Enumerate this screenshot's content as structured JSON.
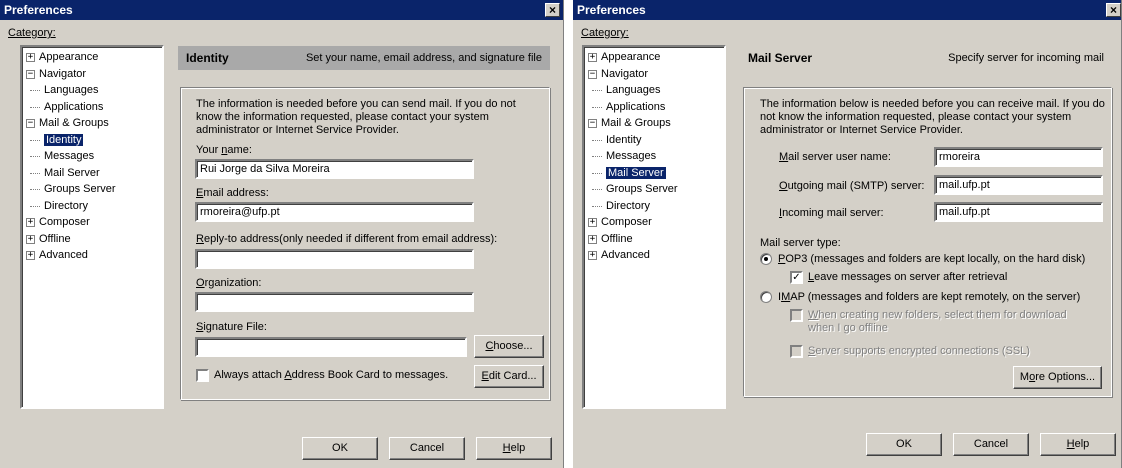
{
  "left": {
    "title": "Preferences",
    "close": "×",
    "category_label": "Category:",
    "tree": [
      {
        "label": "Appearance",
        "box": "+"
      },
      {
        "label": "Navigator",
        "box": "−"
      },
      {
        "label": "Languages"
      },
      {
        "label": "Applications"
      },
      {
        "label": "Mail & Groups",
        "box": "−"
      },
      {
        "label": "Identity",
        "selected": true
      },
      {
        "label": "Messages"
      },
      {
        "label": "Mail Server"
      },
      {
        "label": "Groups Server"
      },
      {
        "label": "Directory"
      },
      {
        "label": "Composer",
        "box": "+"
      },
      {
        "label": "Offline",
        "box": "+"
      },
      {
        "label": "Advanced",
        "box": "+"
      }
    ],
    "panel": {
      "title": "Identity",
      "description": "Set your name, email address, and signature file",
      "intro": [
        "The information is needed before you can send mail.  If you do not",
        "know the information requested, please contact your system",
        "administrator or Internet Service Provider."
      ],
      "name_label_pre": "Your ",
      "name_label_u": "n",
      "name_label_post": "ame:",
      "name_value": "Rui Jorge da Silva Moreira",
      "email_label_pre": "",
      "email_label_u": "E",
      "email_label_post": "mail address:",
      "email_value": "rmoreira@ufp.pt",
      "reply_label_pre": "",
      "reply_label_u": "R",
      "reply_label_post": "eply-to address(only needed if different from email address):",
      "reply_value": "",
      "org_label_pre": "",
      "org_label_u": "O",
      "org_label_post": "rganization:",
      "org_value": "",
      "sig_label_pre": "",
      "sig_label_u": "S",
      "sig_label_post": "ignature File:",
      "sig_value": "",
      "choose_u": "C",
      "choose_post": "hoose...",
      "attach_pre": "Always attach ",
      "attach_u": "A",
      "attach_post": "ddress Book Card to messages.",
      "attach_checked": false,
      "editcard_u": "E",
      "editcard_post": "dit Card..."
    },
    "buttons": {
      "ok": "OK",
      "cancel": "Cancel",
      "help_u": "H",
      "help_post": "elp"
    }
  },
  "right": {
    "title": "Preferences",
    "close": "×",
    "category_label": "Category:",
    "tree": [
      {
        "label": "Appearance",
        "box": "+"
      },
      {
        "label": "Navigator",
        "box": "−"
      },
      {
        "label": "Languages"
      },
      {
        "label": "Applications"
      },
      {
        "label": "Mail & Groups",
        "box": "−"
      },
      {
        "label": "Identity"
      },
      {
        "label": "Messages"
      },
      {
        "label": "Mail Server",
        "selected": true
      },
      {
        "label": "Groups Server"
      },
      {
        "label": "Directory"
      },
      {
        "label": "Composer",
        "box": "+"
      },
      {
        "label": "Offline",
        "box": "+"
      },
      {
        "label": "Advanced",
        "box": "+"
      }
    ],
    "panel": {
      "title": "Mail Server",
      "description": "Specify server for incoming mail",
      "intro": [
        "The information below is needed before you can receive mail.  If you do",
        "not know the information requested, please contact your system",
        "administrator or Internet Service Provider."
      ],
      "user_label_u": "M",
      "user_label_post": "ail server user name:",
      "user_value": "rmoreira",
      "smtp_label_u": "O",
      "smtp_label_post": "utgoing mail (SMTP) server:",
      "smtp_value": "mail.ufp.pt",
      "incoming_label_u": "I",
      "incoming_label_post": "ncoming mail server:",
      "incoming_value": "mail.ufp.pt",
      "type_label": "Mail server type:",
      "pop3_u": "P",
      "pop3_post": "OP3 (messages and folders are kept locally, on the hard disk)",
      "pop3_selected": true,
      "leave_u": "L",
      "leave_post": "eave messages on server after retrieval",
      "leave_checked": true,
      "imap_pre": "I",
      "imap_u": "M",
      "imap_post": "AP (messages and folders are kept remotely, on the server)",
      "imap_selected": false,
      "newfolders_u": "W",
      "newfolders_post": "hen creating new folders, select them for download",
      "newfolders_line2": "when I go offline",
      "ssl_u": "S",
      "ssl_post": "erver supports encrypted connections (SSL)",
      "more_pre": "M",
      "more_u": "o",
      "more_post": "re Options..."
    },
    "buttons": {
      "ok": "OK",
      "cancel": "Cancel",
      "help_u": "H",
      "help_post": "elp"
    }
  },
  "icons": {
    "check": "✓",
    "close": "close-icon"
  }
}
